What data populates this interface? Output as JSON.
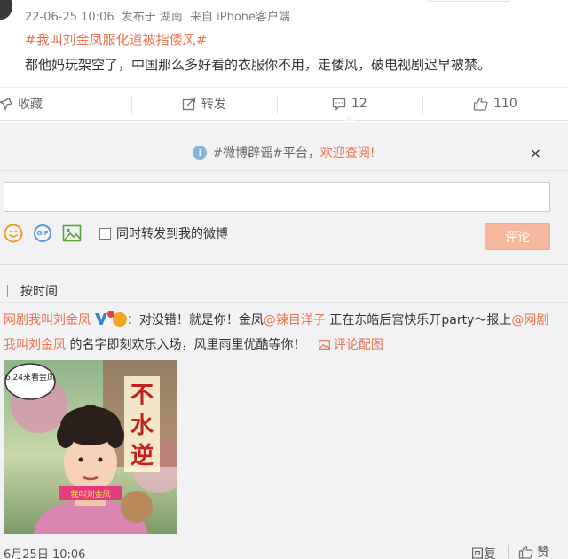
{
  "post": {
    "date": "22-06-25 10:06",
    "published_from": "发布于 湖南",
    "source": "来自 iPhone客户端",
    "topic": "#我叫刘金凤服化道被指倭风#",
    "text": "都他妈玩架空了，中国那么多好看的衣服你不用，走倭风，破电视剧迟早被禁。"
  },
  "actions": {
    "favorite_label": "收藏",
    "repost_label": "转发",
    "comment_count": "12",
    "like_count": "110"
  },
  "comment_box": {
    "notice_text": "#微博辟谣#平台，",
    "notice_link": "欢迎查阅!",
    "notice_close": "×",
    "also_repost_label": "同时转发到我的微博",
    "submit_label": "评论"
  },
  "sort": {
    "label": "按时间"
  },
  "comment": {
    "user": "网剧我叫刘金凤",
    "text_1": "：对没错！就是你！金凤",
    "mention_1": "@辣目洋子",
    "text_2": " 正在东皓后宫快乐开party～报上",
    "mention_2": "@网剧我叫刘金凤",
    "text_3": " 的名字即刻欢乐入场，风里雨里优酷等你！",
    "image_link": "评论配图",
    "image": {
      "top_bubble": "6.24来看金凤",
      "side_text": "不水逆",
      "bottom_tag": "我叫刘金凤"
    },
    "date": "6月25日 10:06",
    "reply_label": "回复",
    "like_label": "赞"
  },
  "colors": {
    "accent": "#eb7350",
    "comment_bg": "#f2f2f5",
    "submit_bg": "#f7b79d",
    "vip_blue": "#3b82d6"
  }
}
